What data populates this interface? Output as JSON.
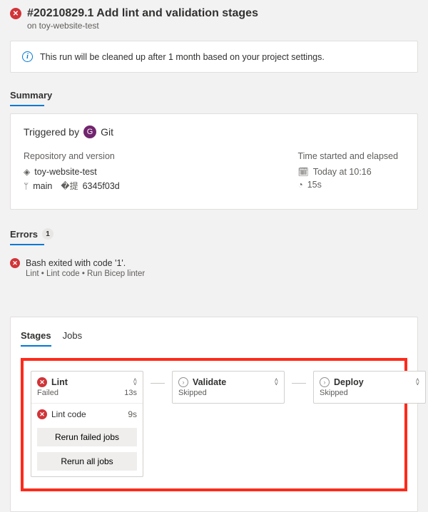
{
  "header": {
    "title": "#20210829.1 Add lint and validation stages",
    "subtitle": "on toy-website-test"
  },
  "cleanup_msg": "This run will be cleaned up after 1 month based on your project settings.",
  "summary_label": "Summary",
  "trigger": {
    "label_prefix": "Triggered by",
    "avatar_letter": "G",
    "actor": "Git",
    "repo_heading": "Repository and version",
    "repo": "toy-website-test",
    "branch": "main",
    "commit": "6345f03d",
    "time_heading": "Time started and elapsed",
    "started": "Today at 10:16",
    "elapsed": "15s"
  },
  "errors": {
    "heading": "Errors",
    "count": "1",
    "items": [
      {
        "title": "Bash exited with code '1'.",
        "path": "Lint • Lint code • Run Bicep linter"
      }
    ]
  },
  "tabs": {
    "stages": "Stages",
    "jobs": "Jobs"
  },
  "stages": [
    {
      "name": "Lint",
      "status": "Failed",
      "duration": "13s",
      "icon": "error",
      "jobs": [
        {
          "name": "Lint code",
          "duration": "9s",
          "icon": "error"
        }
      ],
      "actions": {
        "rerun_failed": "Rerun failed jobs",
        "rerun_all": "Rerun all jobs"
      }
    },
    {
      "name": "Validate",
      "status": "Skipped",
      "duration": "",
      "icon": "skip",
      "jobs": []
    },
    {
      "name": "Deploy",
      "status": "Skipped",
      "duration": "",
      "icon": "skip",
      "jobs": []
    }
  ]
}
